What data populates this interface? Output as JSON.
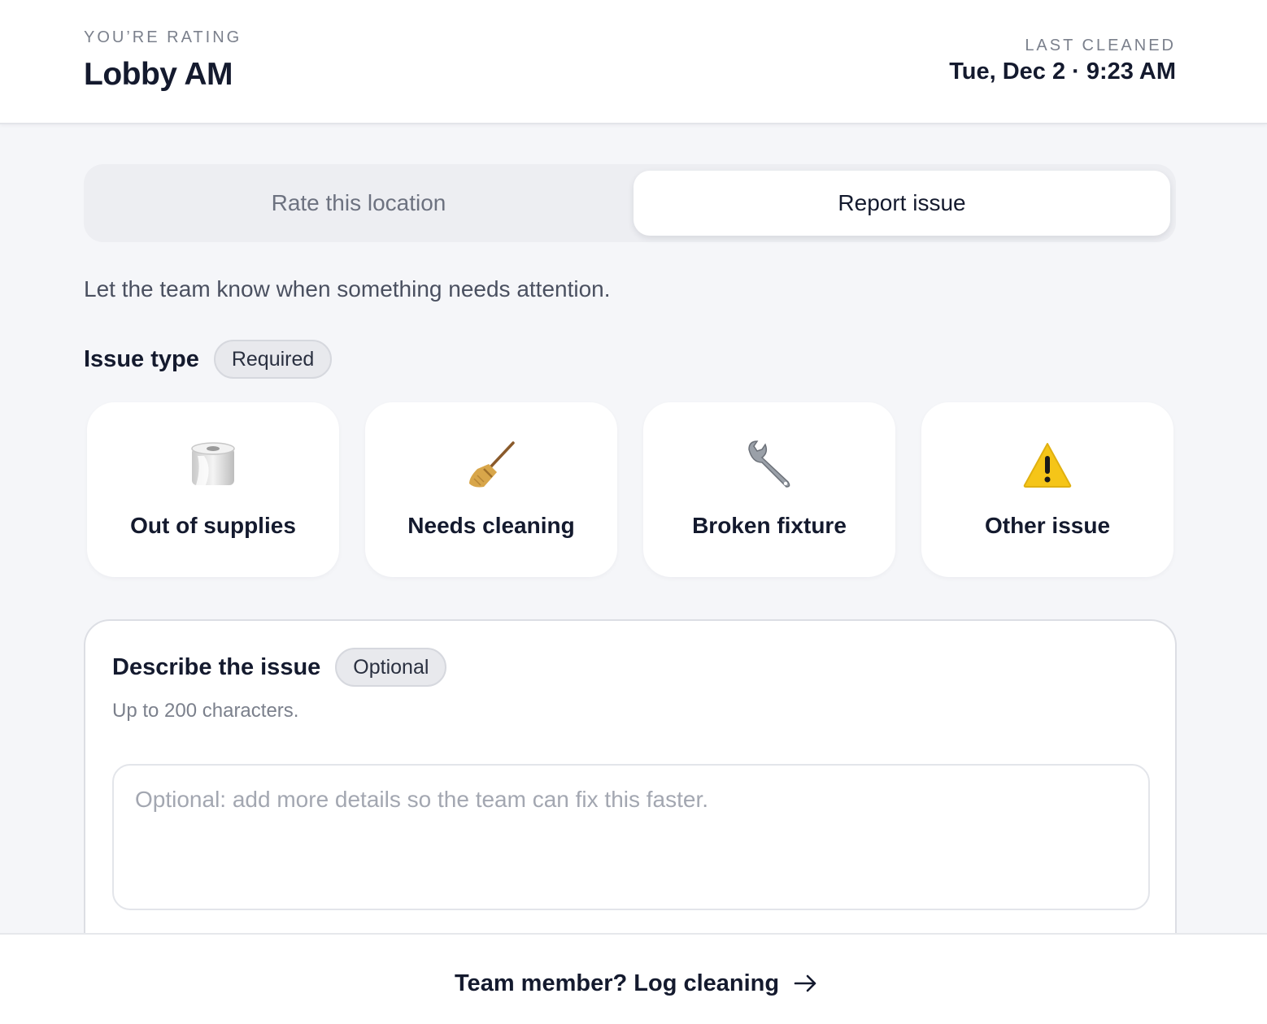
{
  "header": {
    "eyebrow": "YOU’RE RATING",
    "location": "Lobby AM",
    "last_cleaned_label": "LAST CLEANED",
    "last_cleaned_value": "Tue, Dec 2 · 9:23 AM"
  },
  "tabs": [
    {
      "label": "Rate this location",
      "selected": false
    },
    {
      "label": "Report issue",
      "selected": true
    }
  ],
  "intro": "Let the team know when something needs attention.",
  "issue_type": {
    "title": "Issue type",
    "badge": "Required",
    "options": [
      {
        "label": "Out of supplies",
        "icon": "toilet-paper-icon"
      },
      {
        "label": "Needs cleaning",
        "icon": "broom-icon"
      },
      {
        "label": "Broken fixture",
        "icon": "wrench-icon"
      },
      {
        "label": "Other issue",
        "icon": "warning-icon"
      }
    ]
  },
  "describe": {
    "title": "Describe the issue",
    "badge": "Optional",
    "hint": "Up to 200 characters.",
    "placeholder": "Optional: add more details so the team can fix this faster.",
    "value": ""
  },
  "footer": {
    "link_label": "Team member? Log cleaning",
    "icon": "arrow-right-icon"
  },
  "colors": {
    "background": "#f5f6f9",
    "text": "#141a2e",
    "muted": "#7b808c",
    "card": "#ffffff",
    "warning": "#f5c518"
  }
}
